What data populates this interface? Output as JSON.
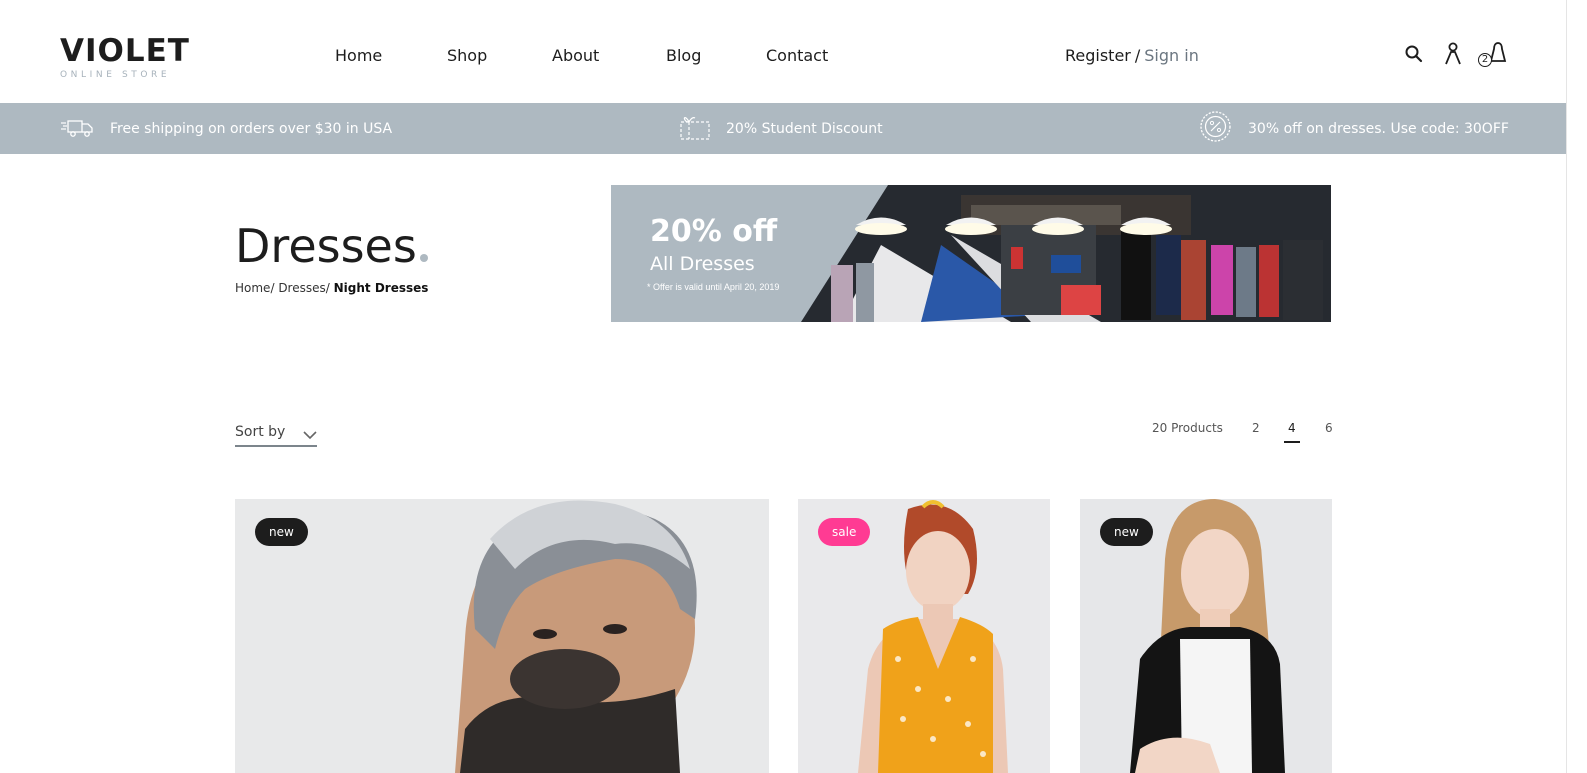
{
  "header": {
    "logo_main": "VIOLET",
    "logo_sub": "ONLINE STORE",
    "nav": [
      "Home",
      "Shop",
      "About",
      "Blog",
      "Contact"
    ],
    "register_label": "Register",
    "separator": "/",
    "signin_label": "Sign in",
    "cart_count": "2",
    "icons": [
      "search-icon",
      "user-icon",
      "cart-icon"
    ]
  },
  "promo_bar": {
    "items": [
      {
        "text": "Free shipping on orders over $30 in USA",
        "icon": "truck-icon"
      },
      {
        "text": "20% Student Discount",
        "icon": "coupon-icon"
      },
      {
        "text": "30% off on dresses. Use code: 30OFF",
        "icon": "percent-badge-icon"
      }
    ]
  },
  "page": {
    "title": "Dresses",
    "breadcrumb": [
      "Home/",
      "Dresses/",
      "Night Dresses"
    ]
  },
  "banner": {
    "headline": "20% off",
    "subheadline": "All Dresses",
    "note": "* Offer is valid until April 20, 2019"
  },
  "toolbar": {
    "sort_label": "Sort by",
    "product_count": "20 Products",
    "view_options": [
      "2",
      "4",
      "6"
    ],
    "active_view": "4"
  },
  "products": [
    {
      "badge": "new",
      "badge_style": "dark"
    },
    {
      "badge": "sale",
      "badge_style": "pink"
    },
    {
      "badge": "new",
      "badge_style": "dark"
    }
  ],
  "colors": {
    "accent": "#aeb9c1",
    "text": "#1d1d1d",
    "sale_badge": "#ff3b93",
    "new_badge": "#1d1d1d",
    "muted": "#6b7680"
  }
}
